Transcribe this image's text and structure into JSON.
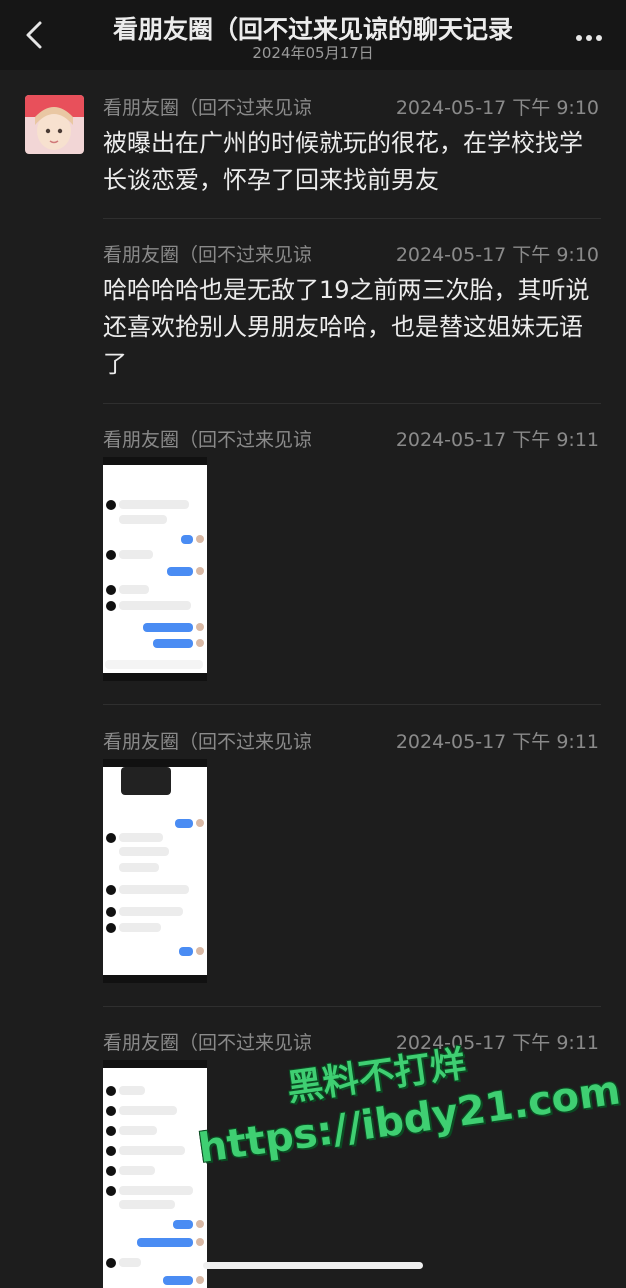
{
  "header": {
    "title": "看朋友圈（回不过来见谅的聊天记录",
    "date": "2024年05月17日"
  },
  "messages": [
    {
      "sender": "看朋友圈（回不过来见谅",
      "time": "2024-05-17 下午 9:10",
      "text": "被曝出在广州的时候就玩的很花，在学校找学长谈恋爱，怀孕了回来找前男友"
    },
    {
      "sender": "看朋友圈（回不过来见谅",
      "time": "2024-05-17 下午 9:10",
      "text": "哈哈哈哈也是无敌了19之前两三次胎，其听说还喜欢抢别人男朋友哈哈，也是替这姐妹无语了"
    },
    {
      "sender": "看朋友圈（回不过来见谅",
      "time": "2024-05-17 下午 9:11",
      "text": ""
    },
    {
      "sender": "看朋友圈（回不过来见谅",
      "time": "2024-05-17 下午 9:11",
      "text": ""
    },
    {
      "sender": "看朋友圈（回不过来见谅",
      "time": "2024-05-17 下午 9:11",
      "text": ""
    }
  ],
  "watermark": {
    "line1": "黑料不打烊",
    "line2": "https://ibdy21.com"
  },
  "colors": {
    "background": "#1d1d1d",
    "bubble_blue": "#4a8cf3",
    "watermark_green": "#3fcf72"
  },
  "icons": {
    "back": "chevron-left-icon",
    "more": "more-dots-icon"
  }
}
